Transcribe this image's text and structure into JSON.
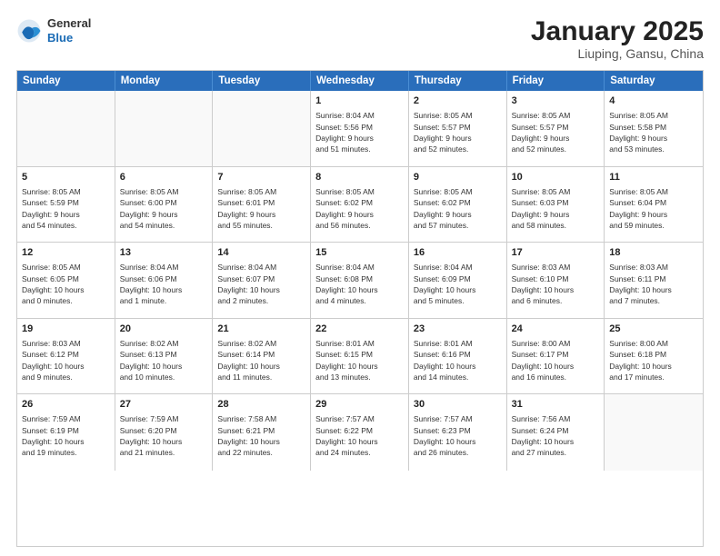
{
  "header": {
    "logo": {
      "general": "General",
      "blue": "Blue"
    },
    "title": "January 2025",
    "location": "Liuping, Gansu, China"
  },
  "weekdays": [
    "Sunday",
    "Monday",
    "Tuesday",
    "Wednesday",
    "Thursday",
    "Friday",
    "Saturday"
  ],
  "weeks": [
    [
      {
        "day": "",
        "text": ""
      },
      {
        "day": "",
        "text": ""
      },
      {
        "day": "",
        "text": ""
      },
      {
        "day": "1",
        "text": "Sunrise: 8:04 AM\nSunset: 5:56 PM\nDaylight: 9 hours\nand 51 minutes."
      },
      {
        "day": "2",
        "text": "Sunrise: 8:05 AM\nSunset: 5:57 PM\nDaylight: 9 hours\nand 52 minutes."
      },
      {
        "day": "3",
        "text": "Sunrise: 8:05 AM\nSunset: 5:57 PM\nDaylight: 9 hours\nand 52 minutes."
      },
      {
        "day": "4",
        "text": "Sunrise: 8:05 AM\nSunset: 5:58 PM\nDaylight: 9 hours\nand 53 minutes."
      }
    ],
    [
      {
        "day": "5",
        "text": "Sunrise: 8:05 AM\nSunset: 5:59 PM\nDaylight: 9 hours\nand 54 minutes."
      },
      {
        "day": "6",
        "text": "Sunrise: 8:05 AM\nSunset: 6:00 PM\nDaylight: 9 hours\nand 54 minutes."
      },
      {
        "day": "7",
        "text": "Sunrise: 8:05 AM\nSunset: 6:01 PM\nDaylight: 9 hours\nand 55 minutes."
      },
      {
        "day": "8",
        "text": "Sunrise: 8:05 AM\nSunset: 6:02 PM\nDaylight: 9 hours\nand 56 minutes."
      },
      {
        "day": "9",
        "text": "Sunrise: 8:05 AM\nSunset: 6:02 PM\nDaylight: 9 hours\nand 57 minutes."
      },
      {
        "day": "10",
        "text": "Sunrise: 8:05 AM\nSunset: 6:03 PM\nDaylight: 9 hours\nand 58 minutes."
      },
      {
        "day": "11",
        "text": "Sunrise: 8:05 AM\nSunset: 6:04 PM\nDaylight: 9 hours\nand 59 minutes."
      }
    ],
    [
      {
        "day": "12",
        "text": "Sunrise: 8:05 AM\nSunset: 6:05 PM\nDaylight: 10 hours\nand 0 minutes."
      },
      {
        "day": "13",
        "text": "Sunrise: 8:04 AM\nSunset: 6:06 PM\nDaylight: 10 hours\nand 1 minute."
      },
      {
        "day": "14",
        "text": "Sunrise: 8:04 AM\nSunset: 6:07 PM\nDaylight: 10 hours\nand 2 minutes."
      },
      {
        "day": "15",
        "text": "Sunrise: 8:04 AM\nSunset: 6:08 PM\nDaylight: 10 hours\nand 4 minutes."
      },
      {
        "day": "16",
        "text": "Sunrise: 8:04 AM\nSunset: 6:09 PM\nDaylight: 10 hours\nand 5 minutes."
      },
      {
        "day": "17",
        "text": "Sunrise: 8:03 AM\nSunset: 6:10 PM\nDaylight: 10 hours\nand 6 minutes."
      },
      {
        "day": "18",
        "text": "Sunrise: 8:03 AM\nSunset: 6:11 PM\nDaylight: 10 hours\nand 7 minutes."
      }
    ],
    [
      {
        "day": "19",
        "text": "Sunrise: 8:03 AM\nSunset: 6:12 PM\nDaylight: 10 hours\nand 9 minutes."
      },
      {
        "day": "20",
        "text": "Sunrise: 8:02 AM\nSunset: 6:13 PM\nDaylight: 10 hours\nand 10 minutes."
      },
      {
        "day": "21",
        "text": "Sunrise: 8:02 AM\nSunset: 6:14 PM\nDaylight: 10 hours\nand 11 minutes."
      },
      {
        "day": "22",
        "text": "Sunrise: 8:01 AM\nSunset: 6:15 PM\nDaylight: 10 hours\nand 13 minutes."
      },
      {
        "day": "23",
        "text": "Sunrise: 8:01 AM\nSunset: 6:16 PM\nDaylight: 10 hours\nand 14 minutes."
      },
      {
        "day": "24",
        "text": "Sunrise: 8:00 AM\nSunset: 6:17 PM\nDaylight: 10 hours\nand 16 minutes."
      },
      {
        "day": "25",
        "text": "Sunrise: 8:00 AM\nSunset: 6:18 PM\nDaylight: 10 hours\nand 17 minutes."
      }
    ],
    [
      {
        "day": "26",
        "text": "Sunrise: 7:59 AM\nSunset: 6:19 PM\nDaylight: 10 hours\nand 19 minutes."
      },
      {
        "day": "27",
        "text": "Sunrise: 7:59 AM\nSunset: 6:20 PM\nDaylight: 10 hours\nand 21 minutes."
      },
      {
        "day": "28",
        "text": "Sunrise: 7:58 AM\nSunset: 6:21 PM\nDaylight: 10 hours\nand 22 minutes."
      },
      {
        "day": "29",
        "text": "Sunrise: 7:57 AM\nSunset: 6:22 PM\nDaylight: 10 hours\nand 24 minutes."
      },
      {
        "day": "30",
        "text": "Sunrise: 7:57 AM\nSunset: 6:23 PM\nDaylight: 10 hours\nand 26 minutes."
      },
      {
        "day": "31",
        "text": "Sunrise: 7:56 AM\nSunset: 6:24 PM\nDaylight: 10 hours\nand 27 minutes."
      },
      {
        "day": "",
        "text": ""
      }
    ]
  ]
}
